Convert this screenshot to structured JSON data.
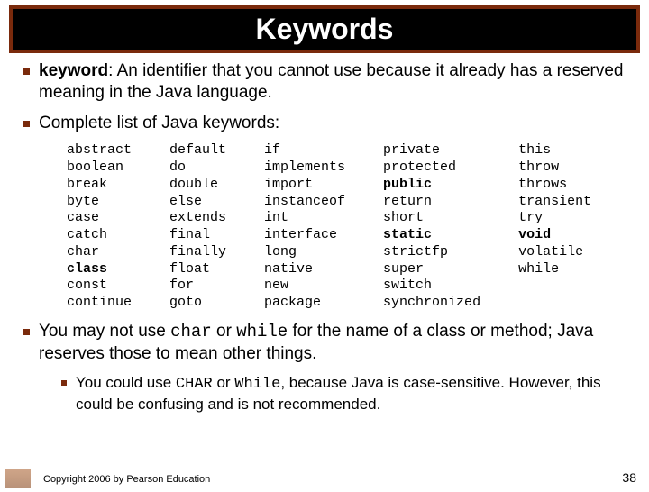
{
  "title": "Keywords",
  "bullet1": {
    "term": "keyword",
    "rest": ": An identifier that you cannot use because it already has a reserved meaning in the Java language."
  },
  "bullet2": "Complete list of Java keywords:",
  "keywords": {
    "col1": [
      {
        "w": "abstract",
        "b": false
      },
      {
        "w": "boolean",
        "b": false
      },
      {
        "w": "break",
        "b": false
      },
      {
        "w": "byte",
        "b": false
      },
      {
        "w": "case",
        "b": false
      },
      {
        "w": "catch",
        "b": false
      },
      {
        "w": "char",
        "b": false
      },
      {
        "w": "class",
        "b": true
      },
      {
        "w": "const",
        "b": false
      },
      {
        "w": "continue",
        "b": false
      }
    ],
    "col2": [
      {
        "w": "default",
        "b": false
      },
      {
        "w": "do",
        "b": false
      },
      {
        "w": "double",
        "b": false
      },
      {
        "w": "else",
        "b": false
      },
      {
        "w": "extends",
        "b": false
      },
      {
        "w": "final",
        "b": false
      },
      {
        "w": "finally",
        "b": false
      },
      {
        "w": "float",
        "b": false
      },
      {
        "w": "for",
        "b": false
      },
      {
        "w": "goto",
        "b": false
      }
    ],
    "col3": [
      {
        "w": "if",
        "b": false
      },
      {
        "w": "implements",
        "b": false
      },
      {
        "w": "import",
        "b": false
      },
      {
        "w": "instanceof",
        "b": false
      },
      {
        "w": "int",
        "b": false
      },
      {
        "w": "interface",
        "b": false
      },
      {
        "w": "long",
        "b": false
      },
      {
        "w": "native",
        "b": false
      },
      {
        "w": "new",
        "b": false
      },
      {
        "w": "package",
        "b": false
      }
    ],
    "col4": [
      {
        "w": "private",
        "b": false
      },
      {
        "w": "protected",
        "b": false
      },
      {
        "w": "public",
        "b": true
      },
      {
        "w": "return",
        "b": false
      },
      {
        "w": "short",
        "b": false
      },
      {
        "w": "static",
        "b": true
      },
      {
        "w": "strictfp",
        "b": false
      },
      {
        "w": "super",
        "b": false
      },
      {
        "w": "switch",
        "b": false
      },
      {
        "w": "synchronized",
        "b": false
      }
    ],
    "col5": [
      {
        "w": "this",
        "b": false
      },
      {
        "w": "throw",
        "b": false
      },
      {
        "w": "throws",
        "b": false
      },
      {
        "w": "transient",
        "b": false
      },
      {
        "w": "try",
        "b": false
      },
      {
        "w": "void",
        "b": true
      },
      {
        "w": "volatile",
        "b": false
      },
      {
        "w": "while",
        "b": false
      }
    ]
  },
  "bullet3": {
    "pre": "You may not use ",
    "code1": "char",
    "mid": " or ",
    "code2": "while",
    "post": " for the name of a class or method; Java reserves those to mean other things."
  },
  "sub1": {
    "pre": "You could use ",
    "code1": "CHAR",
    "mid": " or ",
    "code2": "While",
    "post": ", because Java is case-sensitive. However, this could be confusing and is not recommended."
  },
  "footer": {
    "copyright": "Copyright 2006 by Pearson Education",
    "page": "38"
  }
}
